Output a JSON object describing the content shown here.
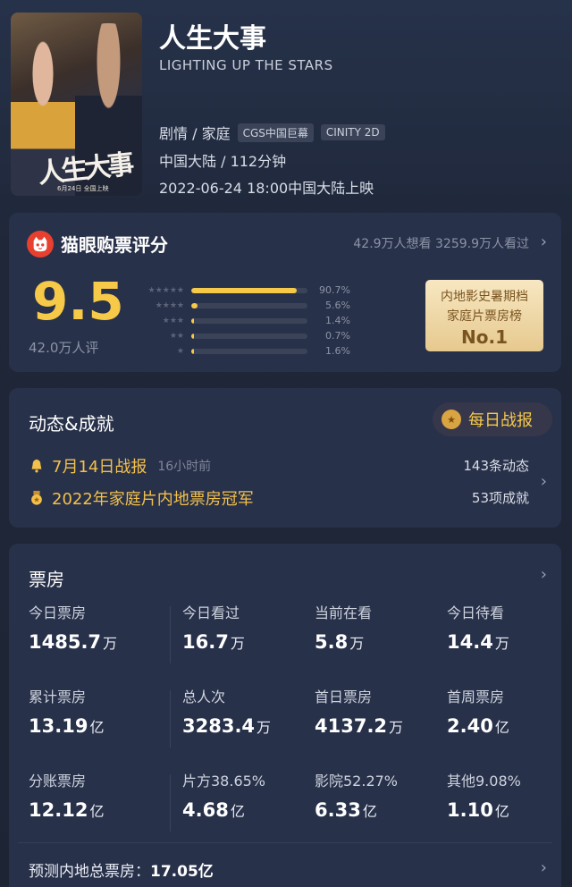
{
  "movie": {
    "title": "人生大事",
    "english_title": "LIGHTING UP THE STARS",
    "genre": "剧情 / 家庭",
    "tags": [
      "CGS中国巨幕",
      "CINITY 2D"
    ],
    "region_duration": "中国大陆 / 112分钟",
    "release": "2022-06-24 18:00中国大陆上映",
    "poster": {
      "title_art": "人生大事",
      "release_note": "6月24日 全国上映"
    }
  },
  "rating": {
    "platform_title": "猫眼购票评分",
    "want_and_watched": "42.9万人想看 3259.9万人看过",
    "score": "9.5",
    "rater_count": "42.0万人评",
    "distribution": [
      {
        "stars": 5,
        "percent_label": "90.7%",
        "value": 0.907
      },
      {
        "stars": 4,
        "percent_label": "5.6%",
        "value": 0.056
      },
      {
        "stars": 3,
        "percent_label": "1.4%",
        "value": 0.014
      },
      {
        "stars": 2,
        "percent_label": "0.7%",
        "value": 0.007
      },
      {
        "stars": 1,
        "percent_label": "1.6%",
        "value": 0.016
      }
    ],
    "badge": {
      "line1": "内地影史暑期档",
      "line2": "家庭片票房榜",
      "line3": "No.1"
    }
  },
  "news": {
    "title": "动态&成就",
    "daily_report_button": "每日战报",
    "items": [
      {
        "text": "7月14日战报",
        "ago": "16小时前",
        "icon": "bell-icon"
      },
      {
        "text": "2022年家庭片内地票房冠军",
        "icon": "medal-icon"
      }
    ],
    "count_updates": "143条动态",
    "count_achievements": "53项成就"
  },
  "boxoffice": {
    "title": "票房",
    "rows": [
      [
        {
          "label": "今日票房",
          "value": "1485.7",
          "unit": "万"
        },
        {
          "label": "今日看过",
          "value": "16.7",
          "unit": "万"
        },
        {
          "label": "当前在看",
          "value": "5.8",
          "unit": "万"
        },
        {
          "label": "今日待看",
          "value": "14.4",
          "unit": "万"
        }
      ],
      [
        {
          "label": "累计票房",
          "value": "13.19",
          "unit": "亿"
        },
        {
          "label": "总人次",
          "value": "3283.4",
          "unit": "万"
        },
        {
          "label": "首日票房",
          "value": "4137.2",
          "unit": "万"
        },
        {
          "label": "首周票房",
          "value": "2.40",
          "unit": "亿"
        }
      ],
      [
        {
          "label": "分账票房",
          "value": "12.12",
          "unit": "亿"
        },
        {
          "label": "片方38.65%",
          "value": "4.68",
          "unit": "亿"
        },
        {
          "label": "影院52.27%",
          "value": "6.33",
          "unit": "亿"
        },
        {
          "label": "其他9.08%",
          "value": "1.10",
          "unit": "亿"
        }
      ]
    ],
    "forecast_label": "预测内地总票房：",
    "forecast_value": "17.05亿"
  },
  "colors": {
    "accent": "#f7c948",
    "brand": "#e8402f",
    "card": "#28314a",
    "background": "#1f2637"
  }
}
